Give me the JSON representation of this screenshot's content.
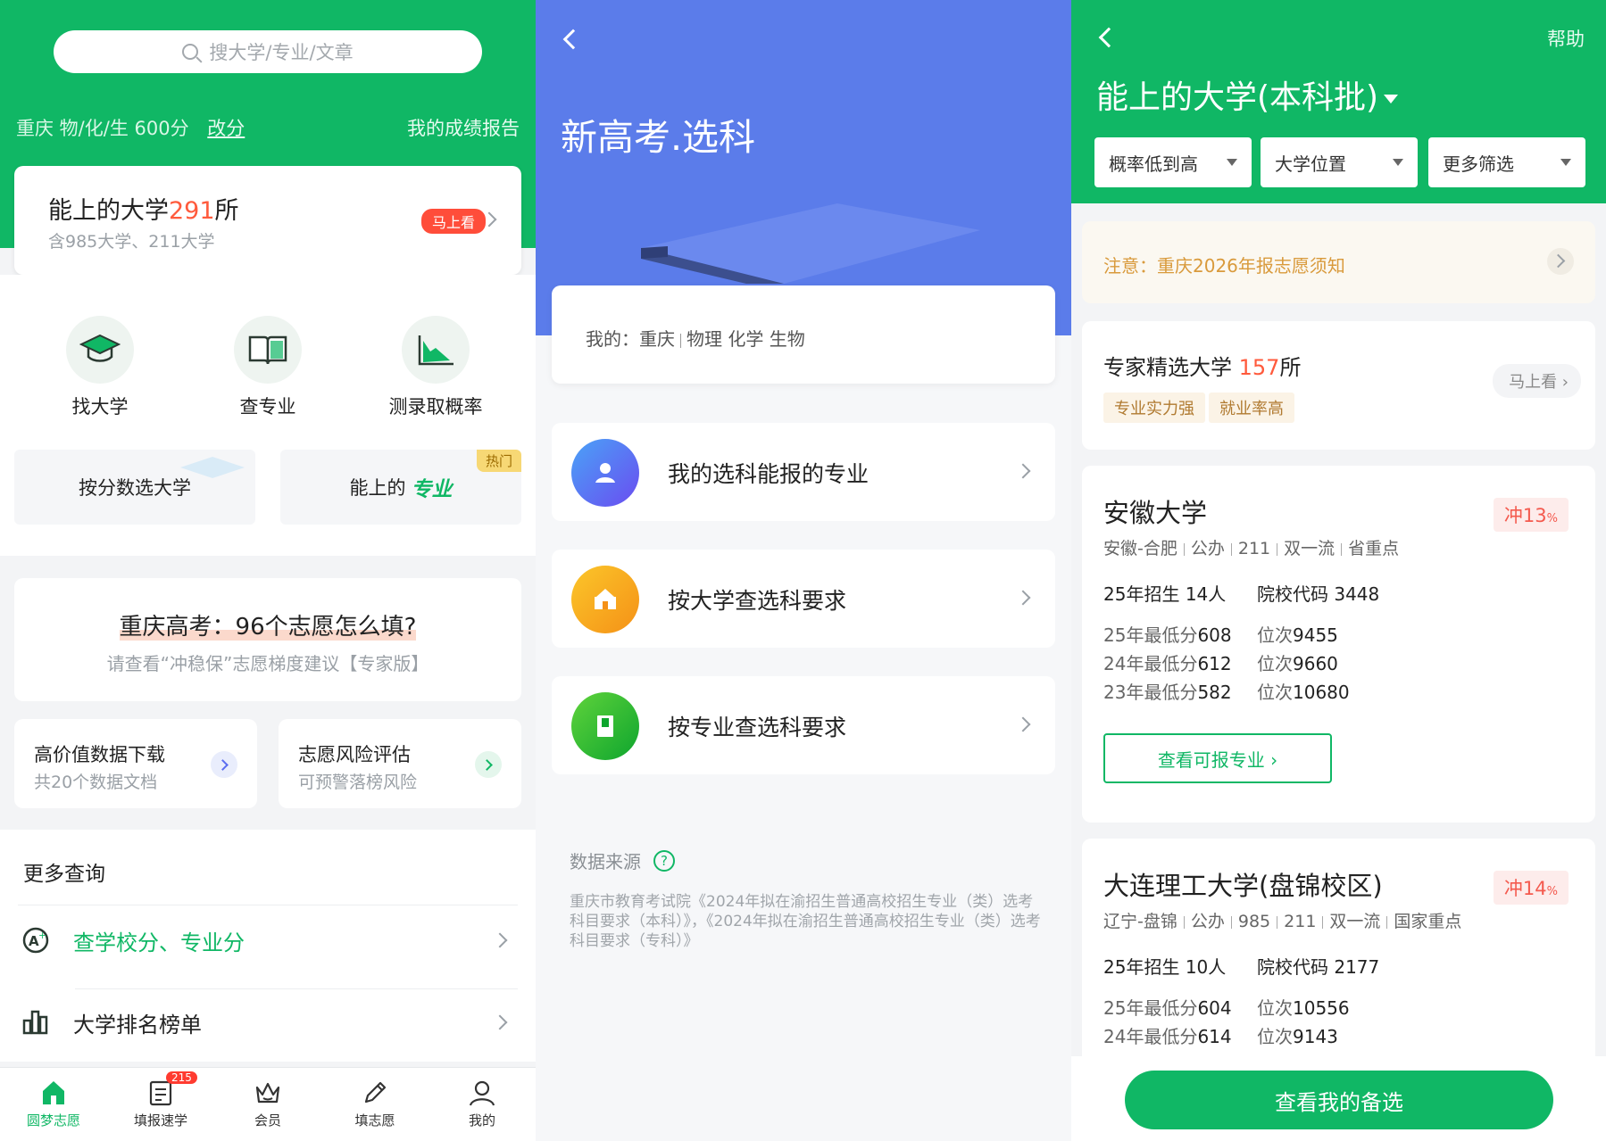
{
  "panel1": {
    "search_placeholder": "搜大学/专业/文章",
    "user_info": "重庆 物/化/生 600分",
    "edit_score": "改分",
    "my_report": "我的成绩报告",
    "card": {
      "title_prefix": "能上的大学",
      "count": "291",
      "title_suffix": "所",
      "subtitle": "含985大学、211大学",
      "badge": "马上看"
    },
    "quick": [
      {
        "label": "找大学",
        "icon": "graduation-cap-icon"
      },
      {
        "label": "查专业",
        "icon": "open-book-icon"
      },
      {
        "label": "测录取概率",
        "icon": "area-chart-icon"
      }
    ],
    "tile_left": "按分数选大学",
    "tile_right_prefix": "能上的",
    "tile_right_highlight": "专业",
    "hot_label": "热门",
    "guide": {
      "title": "重庆高考：96个志愿怎么填?",
      "subtitle": "请查看“冲稳保”志愿梯度建议【专家版】"
    },
    "mini_left": {
      "title": "高价值数据下载",
      "subtitle": "共20个数据文档"
    },
    "mini_right": {
      "title": "志愿风险评估",
      "subtitle": "可预警落榜风险"
    },
    "more_title": "更多查询",
    "more_rows": [
      "查学校分、专业分",
      "大学排名榜单"
    ],
    "tabs": [
      {
        "label": "圆梦志愿",
        "icon": "home-icon"
      },
      {
        "label": "填报速学",
        "icon": "document-icon",
        "badge": "215"
      },
      {
        "label": "会员",
        "icon": "crown-icon"
      },
      {
        "label": "填志愿",
        "icon": "pen-icon"
      },
      {
        "label": "我的",
        "icon": "user-icon"
      }
    ],
    "colors": {
      "brand": "#10b765",
      "accent": "#ff5a3c"
    }
  },
  "panel2": {
    "title": "新高考.选科",
    "mine": {
      "prefix": "我的：",
      "region": "重庆",
      "subjects": "物理 化学 生物"
    },
    "options": [
      {
        "label": "我的选科能报的专业",
        "icon": "person-icon",
        "color": "#5b6cf0"
      },
      {
        "label": "按大学查选科要求",
        "icon": "school-icon",
        "color": "#f7a823"
      },
      {
        "label": "按专业查选科要求",
        "icon": "book-icon",
        "color": "#18b33a"
      }
    ],
    "source_title": "数据来源",
    "source_icon": "?",
    "source_text": "重庆市教育考试院《2024年拟在渝招生普通高校招生专业（类）选考科目要求（本科）》，《2024年拟在渝招生普通高校招生专业（类）选考科目要求（专科）》",
    "colors": {
      "header": "#5b7cea"
    }
  },
  "panel3": {
    "help": "帮助",
    "title": "能上的大学(本科批)",
    "filters": [
      "概率低到高",
      "大学位置",
      "更多筛选"
    ],
    "notice": "注意：重庆2026年报志愿须知",
    "expert": {
      "prefix": "专家精选大学",
      "count": "157",
      "suffix": "所",
      "tags": [
        "专业实力强",
        "就业率高"
      ],
      "button": "马上看"
    },
    "universities": [
      {
        "name": "安徽大学",
        "chance": "冲13",
        "chance_unit": "%",
        "meta": [
          "安徽-合肥",
          "公办",
          "211",
          "双一流",
          "省重点"
        ],
        "enroll_label": "25年招生",
        "enroll": "14人",
        "code_label": "院校代码",
        "code": "3448",
        "scores": [
          {
            "label": "25年最低分",
            "score": "608",
            "rank_label": "位次",
            "rank": "9455"
          },
          {
            "label": "24年最低分",
            "score": "612",
            "rank_label": "位次",
            "rank": "9660"
          },
          {
            "label": "23年最低分",
            "score": "582",
            "rank_label": "位次",
            "rank": "10680"
          }
        ],
        "button": "查看可报专业 ›"
      },
      {
        "name": "大连理工大学(盘锦校区)",
        "chance": "冲14",
        "chance_unit": "%",
        "meta": [
          "辽宁-盘锦",
          "公办",
          "985",
          "211",
          "双一流",
          "国家重点"
        ],
        "enroll_label": "25年招生",
        "enroll": "10人",
        "code_label": "院校代码",
        "code": "2177",
        "scores": [
          {
            "label": "25年最低分",
            "score": "604",
            "rank_label": "位次",
            "rank": "10556"
          },
          {
            "label": "24年最低分",
            "score": "614",
            "rank_label": "位次",
            "rank": "9143"
          }
        ]
      }
    ],
    "bottom_button": "查看我的备选"
  }
}
